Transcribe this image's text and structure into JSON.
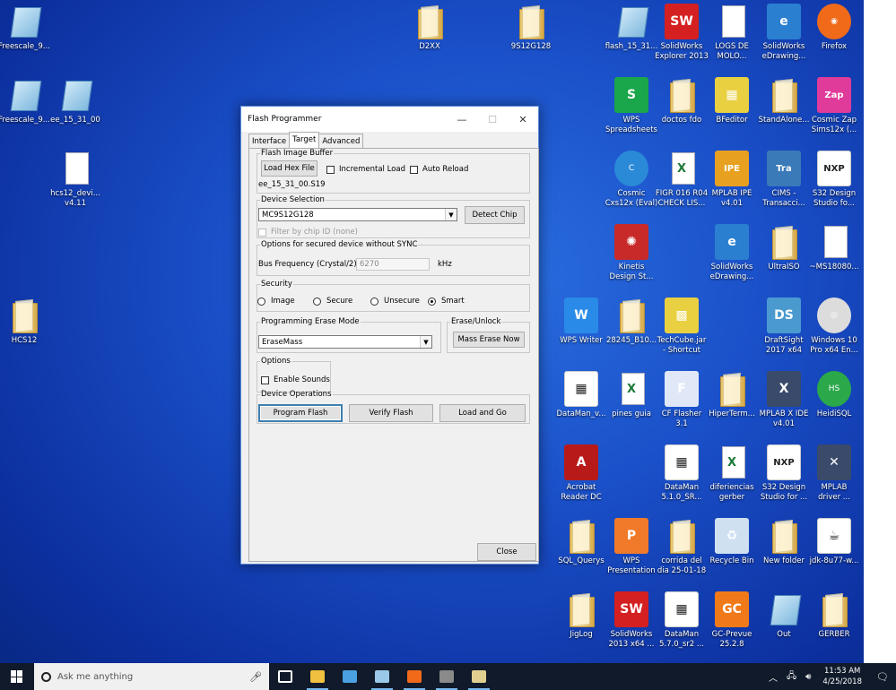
{
  "desktop_icons": [
    {
      "label": "Freescale_9...",
      "kind": "pad",
      "color": "#7fb8de"
    },
    {
      "label": "Freescale_9...",
      "kind": "pad",
      "color": "#7fb8de"
    },
    {
      "label": "ee_15_31_00",
      "kind": "pad",
      "color": "#7fb8de"
    },
    {
      "label": "hcs12_devi...\nv4.11",
      "kind": "doc",
      "color": "#ffffff"
    },
    {
      "label": "HCS12",
      "kind": "folder",
      "color": "#e8c46a"
    },
    {
      "label": "D2XX",
      "kind": "folder",
      "color": "#e8c46a"
    },
    {
      "label": "9S12G128",
      "kind": "folder",
      "color": "#e8c46a"
    },
    {
      "label": "flash_15_31...",
      "kind": "pad",
      "color": "#7fb8de"
    },
    {
      "label": "SolidWorks\nExplorer 2013",
      "kind": "box",
      "color": "#d42020",
      "glyph": "SW"
    },
    {
      "label": "LOGS DE\nMOLO...",
      "kind": "doc",
      "color": "#ffffff"
    },
    {
      "label": "SolidWorks\neDrawing...",
      "kind": "box",
      "color": "#2a7fd0",
      "glyph": "e"
    },
    {
      "label": "Firefox",
      "kind": "round",
      "color": "#f06a1a",
      "glyph": "◉"
    },
    {
      "label": "WPS\nSpreadsheets",
      "kind": "box",
      "color": "#1aa64a",
      "glyph": "S"
    },
    {
      "label": "doctos fdo",
      "kind": "folder",
      "color": "#333333"
    },
    {
      "label": "BFeditor",
      "kind": "box",
      "color": "#e8d040",
      "glyph": "▦"
    },
    {
      "label": "StandAlone...",
      "kind": "folder",
      "color": "#e8c46a"
    },
    {
      "label": "Cosmic Zap\nSims12x (...",
      "kind": "box",
      "color": "#e03a9a",
      "glyph": "Zap"
    },
    {
      "label": "Cosmic\nCxs12x (Eval)",
      "kind": "round",
      "color": "#2a8ad8",
      "glyph": "C"
    },
    {
      "label": "FIGR 016 R04\nCHECK LIS...",
      "kind": "doc",
      "color": "#1d7a3a",
      "glyph": "X"
    },
    {
      "label": "MPLAB IPE\nv4.01",
      "kind": "box",
      "color": "#e8a020",
      "glyph": "IPE"
    },
    {
      "label": "CIMS -\nTransacci...",
      "kind": "box",
      "color": "#3a7ab8",
      "glyph": "Tra"
    },
    {
      "label": "S32 Design\nStudio fo...",
      "kind": "box",
      "color": "#ffffff",
      "glyph": "NXP"
    },
    {
      "label": "Kinetis\nDesign St...",
      "kind": "box",
      "color": "#c82a2a",
      "glyph": "✺"
    },
    {
      "label": "SolidWorks\neDrawing...",
      "kind": "box",
      "color": "#2a7fd0",
      "glyph": "e"
    },
    {
      "label": "UltraISO",
      "kind": "folder",
      "color": "#e8c46a"
    },
    {
      "label": "~MS18080...",
      "kind": "doc",
      "color": "#ffffff"
    },
    {
      "label": "WPS Writer",
      "kind": "box",
      "color": "#2a8ae8",
      "glyph": "W"
    },
    {
      "label": "28245_B10...",
      "kind": "folder",
      "color": "#e8c46a"
    },
    {
      "label": "TechCube.jar\n- Shortcut",
      "kind": "box",
      "color": "#e8d040",
      "glyph": "▩"
    },
    {
      "label": "DraftSight\n2017 x64",
      "kind": "box",
      "color": "#4a9ad0",
      "glyph": "DS"
    },
    {
      "label": "Windows 10\nPro x64 En...",
      "kind": "round",
      "color": "#dcdcdc",
      "glyph": "◎"
    },
    {
      "label": "DataMan_v...",
      "kind": "box",
      "color": "#ffffff",
      "glyph": "▦"
    },
    {
      "label": "pines guia",
      "kind": "doc",
      "color": "#1d7a3a",
      "glyph": "X"
    },
    {
      "label": "CF Flasher\n3.1",
      "kind": "box",
      "color": "#e0e8f8",
      "glyph": "F"
    },
    {
      "label": "HiperTerm...",
      "kind": "folder",
      "color": "#e8c46a"
    },
    {
      "label": "MPLAB X IDE\nv4.01",
      "kind": "box",
      "color": "#3a4a6a",
      "glyph": "X"
    },
    {
      "label": "HeidiSQL",
      "kind": "round",
      "color": "#2aa84a",
      "glyph": "HS"
    },
    {
      "label": "Acrobat\nReader DC",
      "kind": "box",
      "color": "#b81a1a",
      "glyph": "A"
    },
    {
      "label": "DataMan\n5.1.0_SR...",
      "kind": "box",
      "color": "#ffffff",
      "glyph": "▦"
    },
    {
      "label": "diferiencias\ngerber",
      "kind": "doc",
      "color": "#1d7a3a",
      "glyph": "X"
    },
    {
      "label": "S32 Design\nStudio for ...",
      "kind": "box",
      "color": "#ffffff",
      "glyph": "NXP"
    },
    {
      "label": "MPLAB\ndriver ...",
      "kind": "box",
      "color": "#3a4a6a",
      "glyph": "✕"
    },
    {
      "label": "SQL_Querys",
      "kind": "folder",
      "color": "#e8c46a"
    },
    {
      "label": "WPS\nPresentation",
      "kind": "box",
      "color": "#f07a2a",
      "glyph": "P"
    },
    {
      "label": "corrida del\ndia 25-01-18",
      "kind": "folder",
      "color": "#e8c46a"
    },
    {
      "label": "Recycle Bin",
      "kind": "box",
      "color": "#cfe0f0",
      "glyph": "♻"
    },
    {
      "label": "New folder",
      "kind": "folder",
      "color": "#e8c46a"
    },
    {
      "label": "jdk-8u77-w...",
      "kind": "box",
      "color": "#ffffff",
      "glyph": "☕"
    },
    {
      "label": "JigLog",
      "kind": "folder",
      "color": "#e8c46a"
    },
    {
      "label": "SolidWorks\n2013 x64 ...",
      "kind": "box",
      "color": "#d42020",
      "glyph": "SW"
    },
    {
      "label": "DataMan\n5.7.0_sr2 ...",
      "kind": "box",
      "color": "#ffffff",
      "glyph": "▦"
    },
    {
      "label": "GC-Prevue\n25.2.8",
      "kind": "box",
      "color": "#f07a1a",
      "glyph": "GC"
    },
    {
      "label": "Out",
      "kind": "pad",
      "color": "#7fb8de"
    },
    {
      "label": "GERBER",
      "kind": "folder",
      "color": "#e8c46a"
    }
  ],
  "window": {
    "title": "Flash Programmer",
    "minimize": "—",
    "maximize": "☐",
    "close": "✕",
    "tabs": [
      "Interface",
      "Target",
      "Advanced"
    ],
    "active_tab": "Target",
    "flash_image_buffer": {
      "legend": "Flash Image Buffer",
      "load_button": "Load Hex File",
      "incremental_load": "Incremental Load",
      "auto_reload": "Auto Reload",
      "file_name": "ee_15_31_00.S19"
    },
    "device_selection": {
      "legend": "Device Selection",
      "device": "MC9S12G128",
      "detect_button": "Detect Chip",
      "filter_label": "Filter by chip ID (none)"
    },
    "secured_options": {
      "legend": "Options for secured device without SYNC",
      "bus_label": "Bus Frequency (Crystal/2)",
      "bus_value": "6270",
      "unit": "kHz"
    },
    "security": {
      "legend": "Security",
      "options": [
        "Image",
        "Secure",
        "Unsecure",
        "Smart"
      ],
      "selected": "Smart"
    },
    "erase_mode": {
      "legend": "Programming Erase Mode",
      "value": "EraseMass"
    },
    "erase_unlock": {
      "legend": "Erase/Unlock",
      "button": "Mass Erase Now"
    },
    "options": {
      "legend": "Options",
      "enable_sounds": "Enable Sounds"
    },
    "device_operations": {
      "legend": "Device Operations",
      "program": "Program Flash",
      "verify": "Verify Flash",
      "load_go": "Load and Go"
    },
    "close_button": "Close"
  },
  "taskbar": {
    "search_placeholder": "Ask me anything",
    "apps": [
      {
        "name": "task-view",
        "color": "#ffffff",
        "running": false
      },
      {
        "name": "file-explorer",
        "color": "#f0c040",
        "running": true
      },
      {
        "name": "control-panel",
        "color": "#4aa0e0",
        "running": false
      },
      {
        "name": "notepad",
        "color": "#9ac8e8",
        "running": true
      },
      {
        "name": "firefox",
        "color": "#f06a1a",
        "running": true
      },
      {
        "name": "flash-programmer",
        "color": "#8a8a8a",
        "running": true
      },
      {
        "name": "paint",
        "color": "#e0d090",
        "running": true
      }
    ],
    "time": "11:53 AM",
    "date": "4/25/2018"
  }
}
